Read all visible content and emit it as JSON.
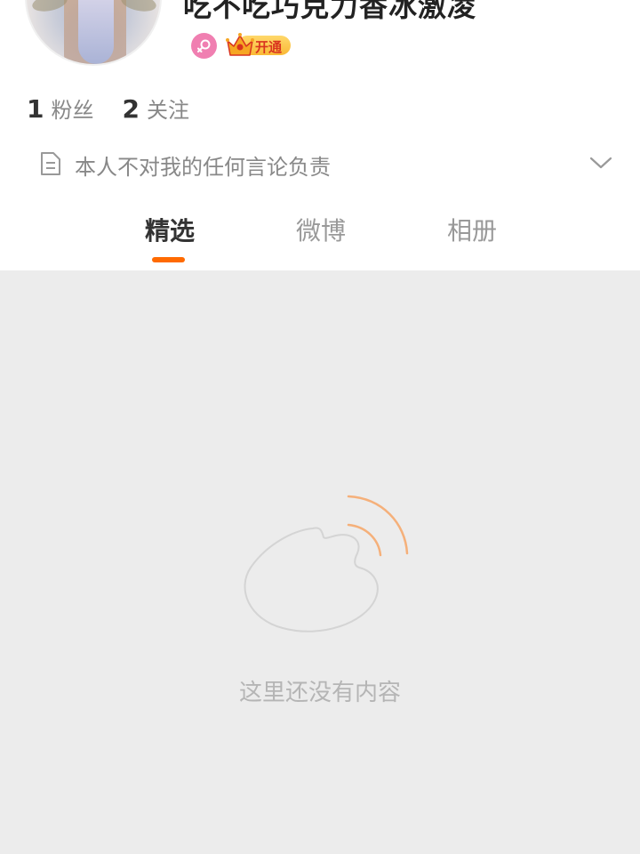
{
  "profile": {
    "username": "吃不吃巧克力香冰激凌",
    "vip_label": "开通"
  },
  "stats": {
    "fans_count": "1",
    "fans_label": "粉丝",
    "following_count": "2",
    "following_label": "关注"
  },
  "bio": {
    "text": "本人不对我的任何言论负责"
  },
  "tabs": [
    {
      "label": "精选",
      "active": true
    },
    {
      "label": "微博",
      "active": false
    },
    {
      "label": "相册",
      "active": false
    }
  ],
  "empty_state": {
    "message": "这里还没有内容"
  },
  "colors": {
    "accent": "#ff6a00",
    "female_badge": "#f07fb1",
    "vip_gold": "#f9b936",
    "page_background": "#ececec"
  },
  "icons": [
    "female-icon",
    "crown-icon",
    "document-icon",
    "chevron-down-icon",
    "weibo-logo-icon"
  ]
}
